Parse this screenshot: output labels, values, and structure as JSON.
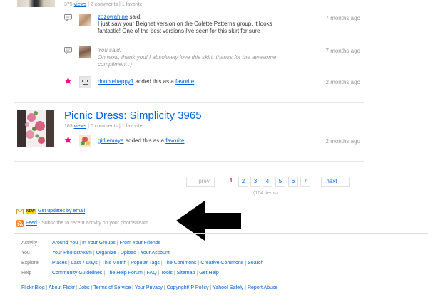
{
  "item1": {
    "views": "375",
    "views_label": "views",
    "comments": "2 comments",
    "favorites": "1 favorite",
    "comments_list": [
      {
        "author": "zozowahine",
        "said": "said:",
        "text_line1": "I just saw your Beignet version on the Colette Patterns group, it looks",
        "text_line2": "fantastic! One of the best versions I've seen for this skirt for sure",
        "time": "7 months ago"
      },
      {
        "author": "You said:",
        "text_line1": "Oh wow, thank you! I absolutely love this skirt, thanks for the awesome",
        "text_line2": "compliment :)",
        "time": "7 months ago"
      }
    ],
    "favorite": {
      "user": "doublehappy1",
      "action": "added this as a",
      "link": "favorite",
      "period": ".",
      "time": "2 months ago"
    }
  },
  "item2": {
    "title": "Picnic Dress: Simplicity 3965",
    "views": "163",
    "views_label": "views",
    "comments": "0 comments",
    "favorites": "1 favorite",
    "favorite": {
      "user": "girliemaya",
      "action": "added this as a",
      "link": "favorite",
      "period": ".",
      "time": "2 months ago"
    }
  },
  "pager": {
    "prev": "← prev",
    "pages": [
      "1",
      "2",
      "3",
      "4",
      "5",
      "6",
      "7"
    ],
    "current": "1",
    "next": "next →",
    "count": "(164 items)"
  },
  "updates": {
    "new_badge": "NEW",
    "email_link": "Get updates by email",
    "feed_link": "Feed",
    "feed_desc": "- Subscribe to recent activity on your photostream"
  },
  "footer": {
    "rows": [
      {
        "label": "Activity",
        "links": [
          "Around You",
          "In Your Groups",
          "From Your Friends"
        ]
      },
      {
        "label": "You",
        "links": [
          "Your Photostream",
          "Organize",
          "Upload",
          "Your Account"
        ]
      },
      {
        "label": "Explore",
        "links": [
          "Places",
          "Last 7 Days",
          "This Month",
          "Popular Tags",
          "The Commons",
          "Creative Commons",
          "Search"
        ]
      },
      {
        "label": "Help",
        "links": [
          "Community Guidelines",
          "The Help Forum",
          "FAQ",
          "Tools",
          "Sitemap",
          "Get Help"
        ]
      }
    ],
    "bottom_links": [
      "Flickr Blog",
      "About Flickr",
      "Jobs",
      "Terms of Service",
      "Your Privacy",
      "Copyright/IP Policy",
      "Yahoo! Safely",
      "Report Abuse"
    ]
  },
  "colors": {
    "link": "#0063dc",
    "accent_pink": "#ff0084",
    "arrow": "#000000"
  },
  "icons": {
    "comment": "speech-bubble-icon",
    "favorite": "star-icon",
    "email": "envelope-icon",
    "feed": "rss-icon",
    "arrow": "left-arrow-icon"
  }
}
